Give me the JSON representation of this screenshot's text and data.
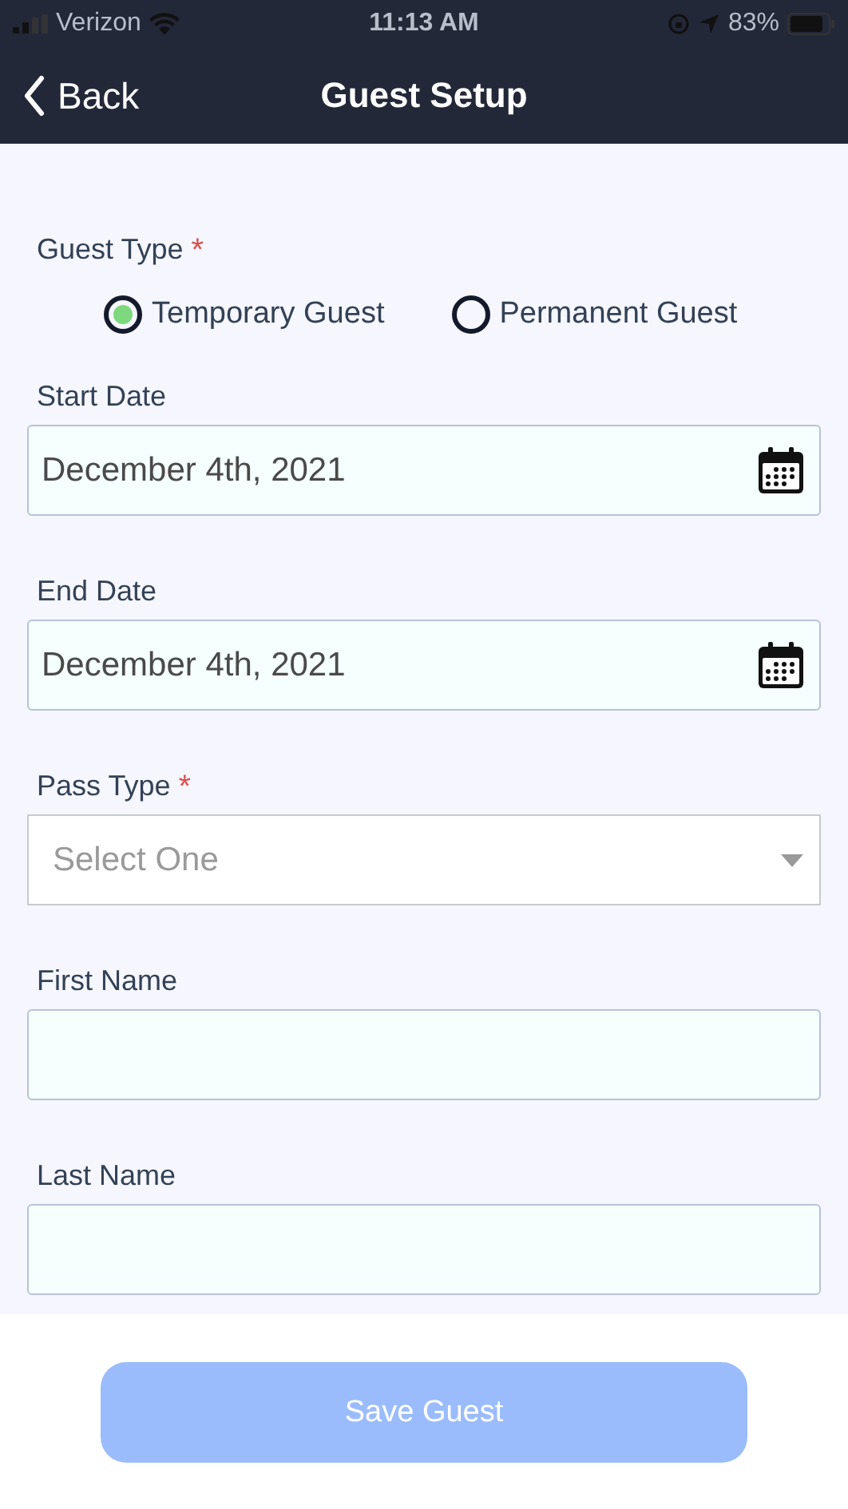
{
  "status_bar": {
    "carrier": "Verizon",
    "time": "11:13 AM",
    "battery": "83%"
  },
  "nav": {
    "back": "Back",
    "title": "Guest Setup"
  },
  "guest_type": {
    "label": "Guest Type",
    "required_mark": "*",
    "options": [
      {
        "label": "Temporary Guest",
        "selected": true
      },
      {
        "label": "Permanent Guest",
        "selected": false
      }
    ]
  },
  "fields": [
    {
      "kind": "date",
      "label": "Start Date",
      "value": "December 4th, 2021"
    },
    {
      "kind": "date",
      "label": "End Date",
      "value": "December 4th, 2021"
    },
    {
      "kind": "select",
      "label": "Pass Type",
      "required_mark": "*",
      "placeholder": "Select One"
    },
    {
      "kind": "text",
      "label": "First Name"
    },
    {
      "kind": "text",
      "label": "Last Name"
    }
  ],
  "save_button": {
    "label": "Save Guest",
    "disabled": true
  }
}
